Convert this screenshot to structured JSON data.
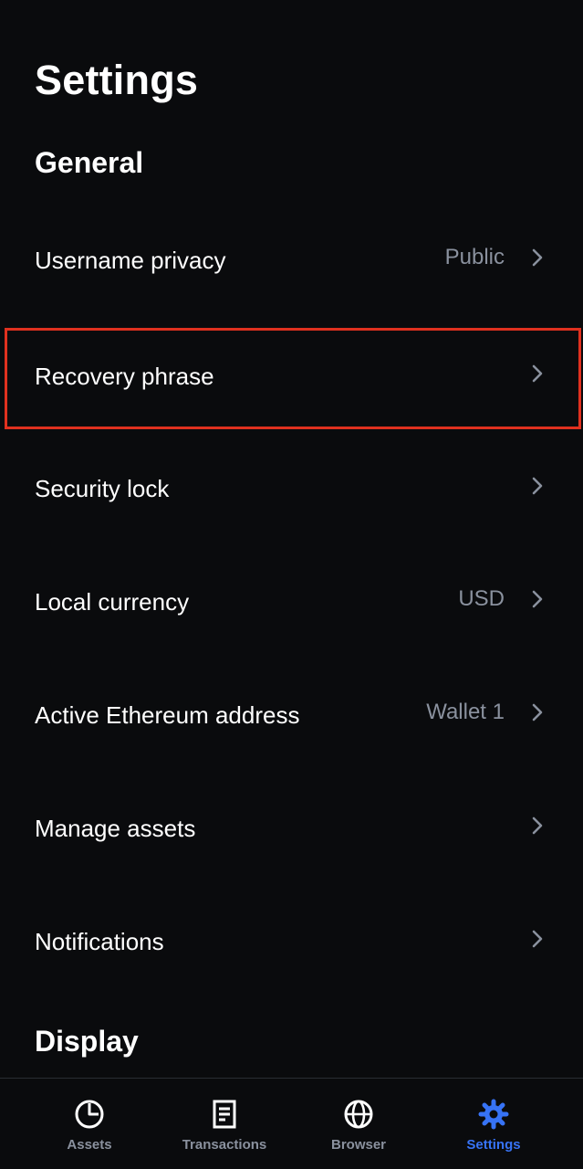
{
  "page": {
    "title": "Settings"
  },
  "sections": {
    "general": "General",
    "display": "Display"
  },
  "rows": [
    {
      "label": "Username privacy",
      "value": "Public"
    },
    {
      "label": "Recovery phrase",
      "value": ""
    },
    {
      "label": "Security lock",
      "value": ""
    },
    {
      "label": "Local currency",
      "value": "USD"
    },
    {
      "label": "Active Ethereum address",
      "value": "Wallet 1"
    },
    {
      "label": "Manage assets",
      "value": ""
    },
    {
      "label": "Notifications",
      "value": ""
    }
  ],
  "tabs": [
    {
      "label": "Assets",
      "icon": "pie-chart-icon",
      "active": false
    },
    {
      "label": "Transactions",
      "icon": "document-icon",
      "active": false
    },
    {
      "label": "Browser",
      "icon": "globe-icon",
      "active": false
    },
    {
      "label": "Settings",
      "icon": "gear-icon",
      "active": true
    }
  ],
  "colors": {
    "background": "#0a0b0d",
    "secondary_text": "#8a919e",
    "accent": "#3773f5",
    "highlight_border": "#e0311f"
  }
}
